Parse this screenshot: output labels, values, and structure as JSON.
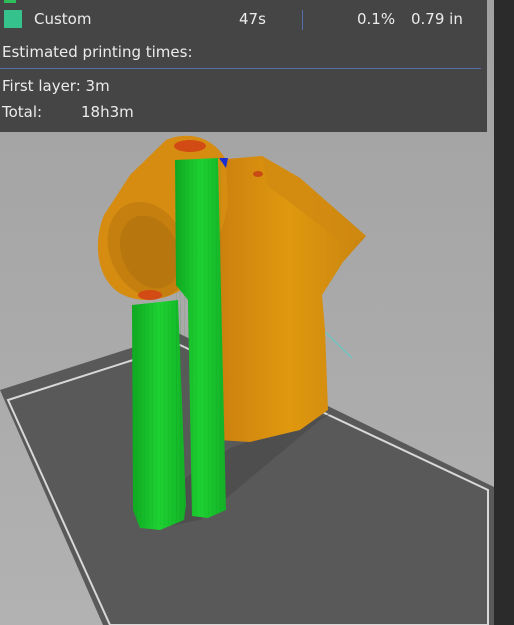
{
  "legend": {
    "partial_label": "",
    "custom": {
      "label": "Custom",
      "time": "47s",
      "percent": "0.1%",
      "length": "0.79 in",
      "color": "#35c28c"
    }
  },
  "estimates": {
    "heading": "Estimated printing times:",
    "first_layer": "First layer: 3m",
    "total_label": "Total:",
    "total_value": "18h3m"
  },
  "colors": {
    "model": "#d98f13",
    "support": "#16c22a",
    "bed": "#5a5a5a",
    "background": "#a7a7a7",
    "panel": "#454545",
    "separator": "#5470a8"
  }
}
